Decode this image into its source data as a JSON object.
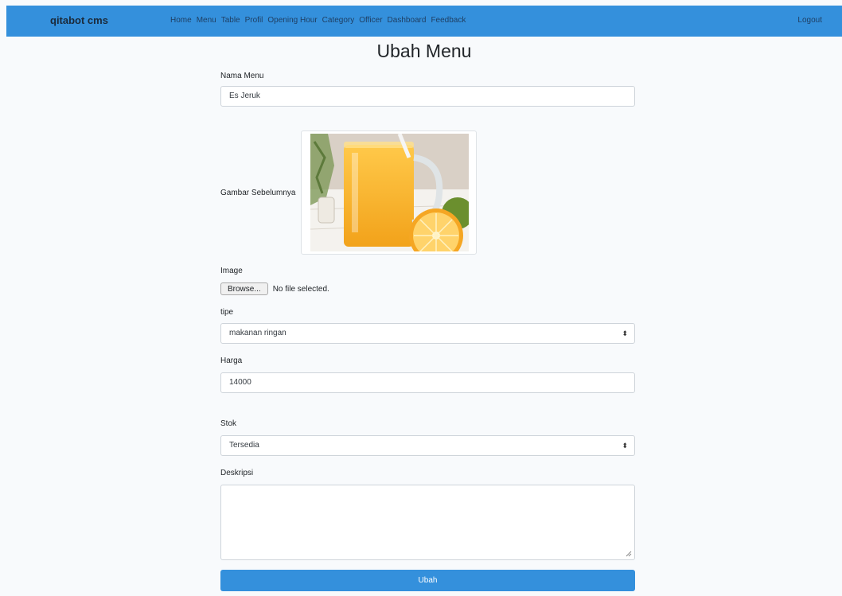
{
  "navbar": {
    "brand": "qitabot cms",
    "links": [
      "Home",
      "Menu",
      "Table",
      "Profil",
      "Opening Hour",
      "Category",
      "Officer",
      "Dashboard",
      "Feedback"
    ],
    "logout": "Logout",
    "color": "#3490dc"
  },
  "page": {
    "title": "Ubah Menu"
  },
  "form": {
    "nama_menu": {
      "label": "Nama Menu",
      "value": "Es Jeruk"
    },
    "gambar_sebelumnya": {
      "label": "Gambar Sebelumnya"
    },
    "image": {
      "label": "Image",
      "button": "Browse...",
      "status": "No file selected."
    },
    "tipe": {
      "label": "tipe",
      "value": "makanan ringan"
    },
    "harga": {
      "label": "Harga",
      "value": "14000"
    },
    "stok": {
      "label": "Stok",
      "value": "Tersedia"
    },
    "deskripsi": {
      "label": "Deskripsi",
      "value": ""
    },
    "submit": "Ubah"
  }
}
